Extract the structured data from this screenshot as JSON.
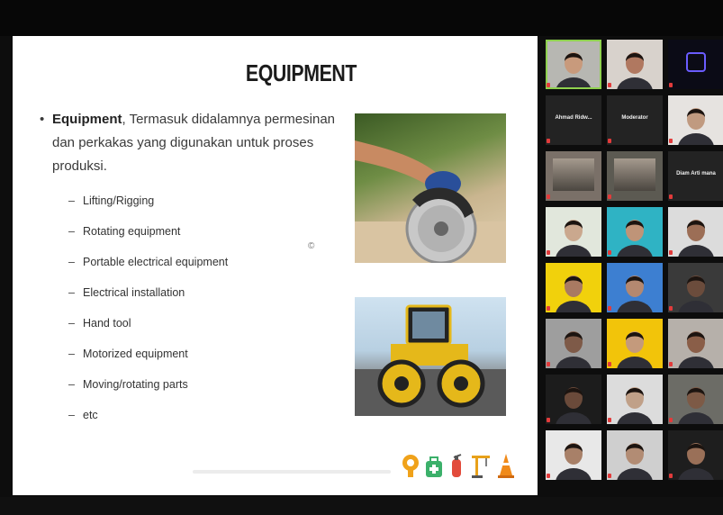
{
  "slide": {
    "title": "EQUIPMENT",
    "bullet_bold": "Equipment",
    "bullet_text": ", Termasuk didalamnya permesinan dan perkakas yang digunakan untuk proses produksi.",
    "sub_items": [
      "Lifting/Rigging",
      "Rotating equipment",
      "Portable electrical equipment",
      "Electrical installation",
      "Hand tool",
      "Motorized equipment",
      "Moving/rotating parts",
      "etc"
    ],
    "cursor_glyph": "©"
  },
  "gallery": {
    "tiles": [
      {
        "label": "",
        "kind": "video-person",
        "active": true,
        "skin": "#c89a7c",
        "bg": "#b7b7b2"
      },
      {
        "label": "",
        "kind": "video-person",
        "skin": "#b07860",
        "bg": "#d8d2cc"
      },
      {
        "label": "",
        "kind": "logo",
        "bg": "#0b0b16"
      },
      {
        "label": "Ahmad Ridw...",
        "kind": "name",
        "bg": "#232323"
      },
      {
        "label": "Moderator",
        "kind": "name",
        "bg": "#232323"
      },
      {
        "label": "",
        "kind": "video-person",
        "skin": "#c09a80",
        "bg": "#e6e3e0"
      },
      {
        "label": "",
        "kind": "video-room",
        "bg": "#7a7068"
      },
      {
        "label": "",
        "kind": "video-group",
        "bg": "#5c5a52"
      },
      {
        "label": "Diam Arti mana",
        "kind": "name",
        "bg": "#232323"
      },
      {
        "label": "",
        "kind": "video-person",
        "skin": "#caa88e",
        "bg": "#e1e7dc"
      },
      {
        "label": "",
        "kind": "video-person",
        "skin": "#bf9478",
        "bg": "#2fb3c4"
      },
      {
        "label": "",
        "kind": "video-person",
        "skin": "#9c6e56",
        "bg": "#dcdcdc"
      },
      {
        "label": "",
        "kind": "video-person",
        "skin": "#a97a62",
        "bg": "#f1d10c"
      },
      {
        "label": "",
        "kind": "video-person",
        "skin": "#b48870",
        "bg": "#3d7fd1"
      },
      {
        "label": "",
        "kind": "video-person",
        "skin": "#6b4c3c",
        "bg": "#3a3a3a"
      },
      {
        "label": "",
        "kind": "video-person",
        "skin": "#7e5a48",
        "bg": "#9e9e9e"
      },
      {
        "label": "",
        "kind": "video-person",
        "skin": "#c49a7c",
        "bg": "#f2c40a"
      },
      {
        "label": "",
        "kind": "video-person",
        "skin": "#8a5e48",
        "bg": "#b6b0aa"
      },
      {
        "label": "",
        "kind": "video-person",
        "skin": "#6a4a3a",
        "bg": "#1c1c1c"
      },
      {
        "label": "",
        "kind": "video-person",
        "skin": "#c0a088",
        "bg": "#dcdcdc"
      },
      {
        "label": "",
        "kind": "video-person",
        "skin": "#7d5a46",
        "bg": "#6c6c66"
      },
      {
        "label": "",
        "kind": "video-person",
        "skin": "#a88068",
        "bg": "#e8e8e8"
      },
      {
        "label": "",
        "kind": "video-person",
        "skin": "#b28c74",
        "bg": "#cfcfcf"
      },
      {
        "label": "",
        "kind": "video-person",
        "skin": "#9a7058",
        "bg": "#1e1e1e"
      }
    ]
  },
  "colors": {
    "active_border": "#8fd14f",
    "mute": "#e23b3b"
  }
}
